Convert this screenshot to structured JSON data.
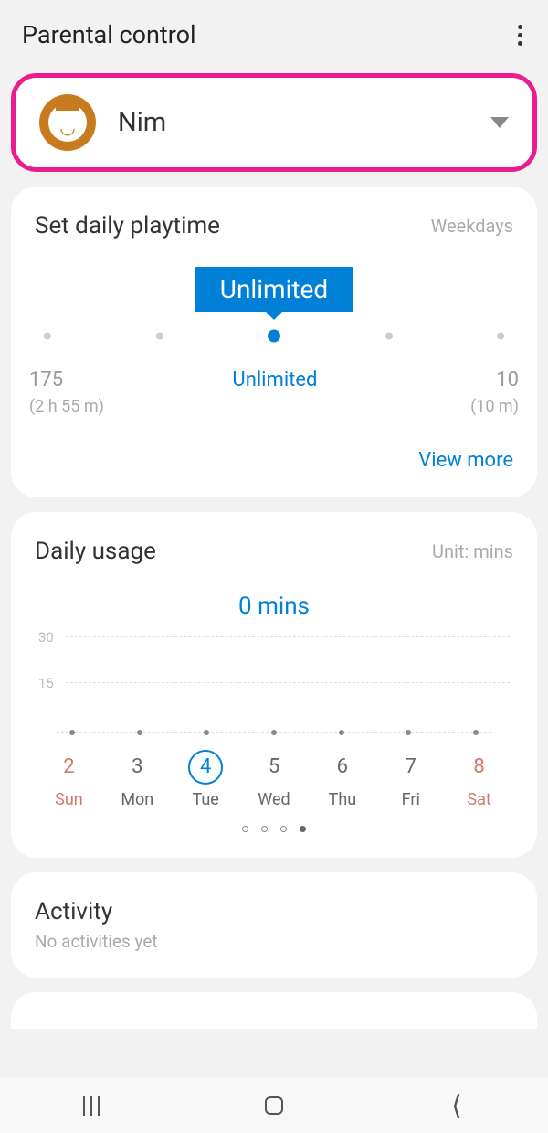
{
  "header": {
    "title": "Parental control"
  },
  "profile": {
    "name": "Nim"
  },
  "playtime": {
    "title": "Set daily playtime",
    "subtitle": "Weekdays",
    "tooltip": "Unlimited",
    "labels": {
      "left": "175",
      "left_sub": "(2 h 55 m)",
      "center": "Unlimited",
      "right": "10",
      "right_sub": "(10 m)"
    },
    "view_more": "View more"
  },
  "usage": {
    "title": "Daily usage",
    "unit": "Unit: mins",
    "value": "0 mins",
    "grid": {
      "g30": "30",
      "g15": "15"
    },
    "days": [
      {
        "num": "2",
        "name": "Sun"
      },
      {
        "num": "3",
        "name": "Mon"
      },
      {
        "num": "4",
        "name": "Tue"
      },
      {
        "num": "5",
        "name": "Wed"
      },
      {
        "num": "6",
        "name": "Thu"
      },
      {
        "num": "7",
        "name": "Fri"
      },
      {
        "num": "8",
        "name": "Sat"
      }
    ]
  },
  "activity": {
    "title": "Activity",
    "subtitle": "No activities yet"
  },
  "chart_data": {
    "type": "bar",
    "title": "Daily usage",
    "xlabel": "",
    "ylabel": "mins",
    "ylim": [
      0,
      30
    ],
    "categories": [
      "Sun 2",
      "Mon 3",
      "Tue 4",
      "Wed 5",
      "Thu 6",
      "Fri 7",
      "Sat 8"
    ],
    "values": [
      0,
      0,
      0,
      0,
      0,
      0,
      0
    ],
    "selected_index": 2,
    "selected_value_label": "0 mins"
  }
}
